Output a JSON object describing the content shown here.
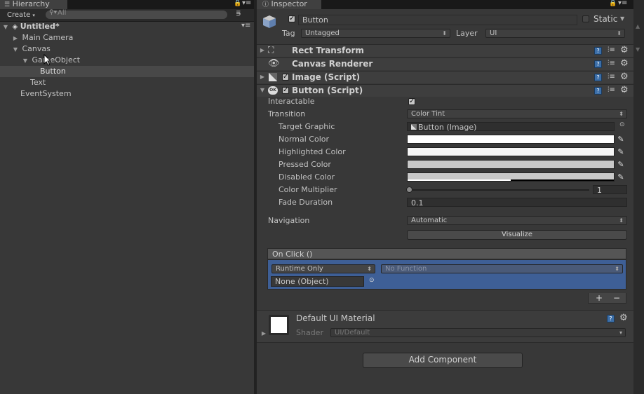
{
  "hierarchy": {
    "tab_title": "Hierarchy",
    "create_label": "Create",
    "search_placeholder": "All",
    "scene_name": "Untitled*",
    "items": [
      {
        "label": "Main Camera"
      },
      {
        "label": "Canvas"
      },
      {
        "label": "GameObject"
      },
      {
        "label": "Button"
      },
      {
        "label": "Text"
      },
      {
        "label": "EventSystem"
      }
    ]
  },
  "inspector": {
    "tab_title": "Inspector",
    "object_name": "Button",
    "static_label": "Static",
    "tag_label": "Tag",
    "tag_value": "Untagged",
    "layer_label": "Layer",
    "layer_value": "UI",
    "components": {
      "rect_transform": "Rect Transform",
      "canvas_renderer": "Canvas Renderer",
      "image": "Image (Script)",
      "button": "Button (Script)"
    },
    "button": {
      "interactable_label": "Interactable",
      "transition_label": "Transition",
      "transition_value": "Color Tint",
      "target_graphic_label": "Target Graphic",
      "target_graphic_value": "Button (Image)",
      "normal_color_label": "Normal Color",
      "highlighted_color_label": "Highlighted Color",
      "pressed_color_label": "Pressed Color",
      "disabled_color_label": "Disabled Color",
      "color_multiplier_label": "Color Multiplier",
      "color_multiplier_value": "1",
      "fade_duration_label": "Fade Duration",
      "fade_duration_value": "0.1",
      "navigation_label": "Navigation",
      "navigation_value": "Automatic",
      "visualize_label": "Visualize"
    },
    "on_click": {
      "title": "On Click ()",
      "runtime_value": "Runtime Only",
      "function_value": "No Function",
      "object_value": "None (Object)",
      "add_label": "+",
      "remove_label": "−"
    },
    "material": {
      "name": "Default UI Material",
      "shader_label": "Shader",
      "shader_value": "UI/Default"
    },
    "add_component_label": "Add Component"
  },
  "colors": {
    "panel_bg": "#383838",
    "selection_blue": "#3e5f96",
    "selected_row": "#484848"
  }
}
